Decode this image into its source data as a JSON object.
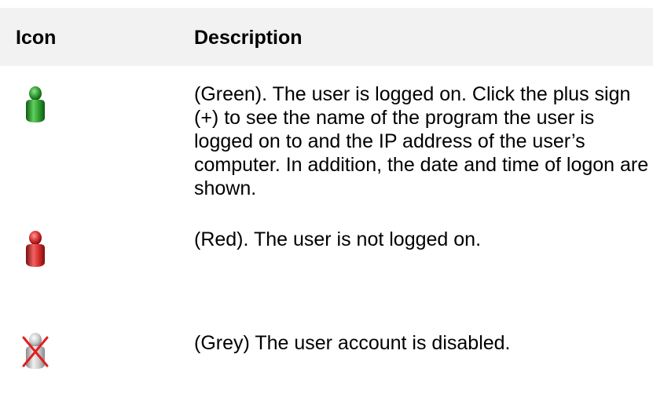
{
  "table": {
    "headers": {
      "icon": "Icon",
      "description": "Description"
    },
    "rows": [
      {
        "icon": "user-logged-on-green-icon",
        "description": "(Green). The user is logged on. Click the plus sign (+) to see the name of the program the user is logged on to and the IP address of the user’s computer. In addition, the date and time of logon are shown."
      },
      {
        "icon": "user-not-logged-on-red-icon",
        "description": "(Red). The user is not logged on."
      },
      {
        "icon": "user-disabled-grey-icon",
        "description": "(Grey) The user account is disabled."
      }
    ]
  },
  "colors": {
    "header_background": "#f2f2f2",
    "green_user": "#2e9a2e",
    "red_user": "#d42a2a",
    "grey_user": "#c9c9c9",
    "disabled_cross": "#e02020"
  }
}
